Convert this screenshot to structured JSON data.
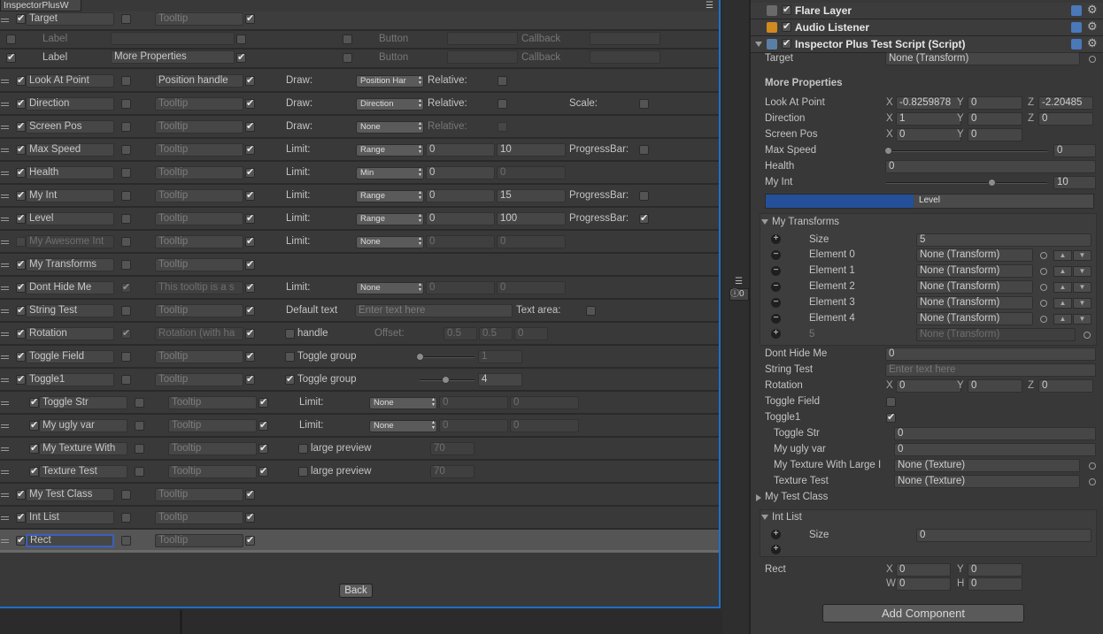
{
  "window": {
    "title": "InspectorPlusW",
    "menu_icon": "menu-icon"
  },
  "top_rows": {
    "target": {
      "label": "Target",
      "tooltip": "Tooltip"
    },
    "label_row1": {
      "label": "Label",
      "button": "Button",
      "callback": "Callback"
    },
    "label_row2": {
      "label": "Label",
      "value": "More Properties",
      "button": "Button",
      "callback": "Callback"
    }
  },
  "props": [
    {
      "name": "Look At Point",
      "tooltip": "Position handle",
      "kind": "Draw:",
      "dd": "Position Har",
      "extra": "Relative:"
    },
    {
      "name": "Direction",
      "tooltip": "Tooltip",
      "kind": "Draw:",
      "dd": "Direction",
      "extra": "Relative:",
      "extra2": "Scale:"
    },
    {
      "name": "Screen Pos",
      "tooltip": "Tooltip",
      "kind": "Draw:",
      "dd": "None",
      "extra": "Relative:"
    },
    {
      "name": "Max Speed",
      "tooltip": "Tooltip",
      "kind": "Limit:",
      "dd": "Range",
      "v1": "0",
      "v2": "10",
      "extra": "ProgressBar:"
    },
    {
      "name": "Health",
      "tooltip": "Tooltip",
      "kind": "Limit:",
      "dd": "Min",
      "v1": "0",
      "v2": "0"
    },
    {
      "name": "My Int",
      "tooltip": "Tooltip",
      "kind": "Limit:",
      "dd": "Range",
      "v1": "0",
      "v2": "15",
      "extra": "ProgressBar:"
    },
    {
      "name": "Level",
      "tooltip": "Tooltip",
      "kind": "Limit:",
      "dd": "Range",
      "v1": "0",
      "v2": "100",
      "extra": "ProgressBar:"
    },
    {
      "name": "My Awesome Int",
      "tooltip": "Tooltip",
      "kind": "Limit:",
      "dd": "None",
      "v1": "0",
      "v2": "0"
    },
    {
      "name": "My Transforms",
      "tooltip": "Tooltip"
    },
    {
      "name": "Dont Hide Me",
      "tooltip": "This tooltip is a s",
      "kind": "Limit:",
      "dd": "None",
      "v1": "0",
      "v2": "0"
    },
    {
      "name": "String Test",
      "tooltip": "Tooltip",
      "kind": "Default text",
      "text": "Enter text here",
      "extra": "Text area:"
    },
    {
      "name": "Rotation",
      "tooltip": "Rotation (with ha",
      "handle": "handle",
      "offset": "Offset:",
      "o1": "0.5",
      "o2": "0.5",
      "o3": "0"
    },
    {
      "name": "Toggle Field",
      "tooltip": "Tooltip",
      "group": "Toggle group",
      "gval": "1"
    },
    {
      "name": "Toggle1",
      "tooltip": "Tooltip",
      "group": "Toggle group",
      "gval": "4"
    },
    {
      "name": "Toggle Str",
      "tooltip": "Tooltip",
      "kind": "Limit:",
      "dd": "None",
      "v1": "0",
      "v2": "0"
    },
    {
      "name": "My ugly var",
      "tooltip": "Tooltip",
      "kind": "Limit:",
      "dd": "None",
      "v1": "0",
      "v2": "0"
    },
    {
      "name": "My Texture With",
      "tooltip": "Tooltip",
      "preview": "large preview",
      "pval": "70"
    },
    {
      "name": "Texture Test",
      "tooltip": "Tooltip",
      "preview": "large preview",
      "pval": "70"
    },
    {
      "name": "My Test Class",
      "tooltip": "Tooltip"
    },
    {
      "name": "Int List",
      "tooltip": "Tooltip"
    },
    {
      "name": "Rect",
      "tooltip": "Tooltip"
    }
  ],
  "back_label": "Back",
  "mid": {
    "count": "0"
  },
  "inspector": {
    "components": [
      "Flare Layer",
      "Audio Listener",
      "Inspector Plus Test Script (Script)"
    ],
    "target_label": "Target",
    "target_value": "None (Transform)",
    "more_properties": "More Properties",
    "look_at": {
      "label": "Look At Point",
      "x": "-0.8259878",
      "y": "0",
      "z": "-2.20485"
    },
    "direction": {
      "label": "Direction",
      "x": "1",
      "y": "0",
      "z": "0"
    },
    "screen_pos": {
      "label": "Screen Pos",
      "x": "0",
      "y": "0"
    },
    "max_speed": {
      "label": "Max Speed",
      "value": "0",
      "slider_fraction": 0
    },
    "health": {
      "label": "Health",
      "value": "0"
    },
    "my_int": {
      "label": "My Int",
      "value": "10",
      "slider_fraction": 0.6667
    },
    "level": {
      "label": "Level",
      "fraction": 0.45
    },
    "transforms": {
      "label": "My Transforms",
      "size_label": "Size",
      "size": "5",
      "elements": [
        {
          "label": "Element 0",
          "value": "None (Transform)"
        },
        {
          "label": "Element 1",
          "value": "None (Transform)"
        },
        {
          "label": "Element 2",
          "value": "None (Transform)"
        },
        {
          "label": "Element 3",
          "value": "None (Transform)"
        },
        {
          "label": "Element 4",
          "value": "None (Transform)"
        }
      ],
      "next_index": "5",
      "next_value": "None (Transform)"
    },
    "dont_hide": {
      "label": "Dont Hide Me",
      "value": "0"
    },
    "string_test": {
      "label": "String Test",
      "placeholder": "Enter text here"
    },
    "rotation": {
      "label": "Rotation",
      "x": "0",
      "y": "0",
      "z": "0"
    },
    "toggle_field": {
      "label": "Toggle Field"
    },
    "toggle1": {
      "label": "Toggle1"
    },
    "toggle_str": {
      "label": "Toggle Str",
      "value": "0"
    },
    "ugly": {
      "label": "My ugly var",
      "value": "0"
    },
    "tex_large": {
      "label": "My Texture With Large I",
      "value": "None (Texture)"
    },
    "tex_test": {
      "label": "Texture Test",
      "value": "None (Texture)"
    },
    "test_class": {
      "label": "My Test Class"
    },
    "int_list": {
      "label": "Int List",
      "size_label": "Size",
      "size": "0"
    },
    "rect": {
      "label": "Rect",
      "x": "0",
      "y": "0",
      "w": "0",
      "h": "0"
    },
    "add_component": "Add Component",
    "axes": {
      "x": "X",
      "y": "Y",
      "z": "Z",
      "w": "W",
      "h": "H"
    }
  }
}
